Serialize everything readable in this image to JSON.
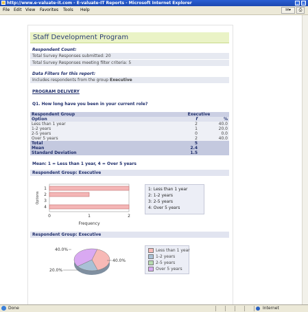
{
  "window": {
    "title": "http://www.e-valuate-it.com - E-valuate-IT Reports - Microsoft Internet Explorer"
  },
  "menu": {
    "items": [
      "File",
      "Edit",
      "View",
      "Favorites",
      "Tools",
      "Help"
    ]
  },
  "report": {
    "title": "Staff Development Program",
    "respondent_count_label": "Respondent Count:",
    "total_submitted": "Total Survey Responses submitted: 20",
    "total_meeting": "Total Survey Responses meeting filter criteria: 5",
    "filters_label": "Data Filters for this report:",
    "filter_text": "Includes respondents from the group",
    "filter_group": "Executive",
    "section_link": "PROGRAM DELIVERY",
    "question": "Q1. How long have you been in your current role?",
    "table": {
      "header_left": "Respondent Group",
      "header_right": "Executive",
      "option_label": "Option",
      "col_f": "f",
      "col_pct": "%",
      "rows": [
        {
          "option": "Less than 1 year",
          "f": "2",
          "pct": "40.0"
        },
        {
          "option": "1-2 years",
          "f": "1",
          "pct": "20.0"
        },
        {
          "option": "2-5 years",
          "f": "0",
          "pct": "0.0"
        },
        {
          "option": "Over 5 years",
          "f": "2",
          "pct": "40.0"
        }
      ],
      "total_label": "Total",
      "total_value": "5",
      "mean_label": "Mean",
      "mean_value": "2.4",
      "sd_label": "Standard Deviation",
      "sd_value": "1.5",
      "mean_note": "Mean: 1 = Less than 1 year, 4 = Over 5 years"
    },
    "bar_section_title": "Respondent Group: Executive",
    "pie_section_title": "Respondent Group: Executive"
  },
  "chart_data": [
    {
      "type": "bar",
      "orientation": "horizontal",
      "categories": [
        "1",
        "2",
        "3",
        "4"
      ],
      "values": [
        2,
        1,
        0,
        2
      ],
      "xlabel": "Frequency",
      "ylabel": "Options",
      "xlim": [
        0,
        2
      ],
      "x_ticks": [
        "0",
        "1",
        "2"
      ],
      "bar_color": "#f4b6b6",
      "legend": [
        "1:  Less than 1 year",
        "2:  1-2 years",
        "3:  2-5 years",
        "4:  Over 5 years"
      ]
    },
    {
      "type": "pie",
      "categories": [
        "Less than 1 year",
        "1-2 years",
        "2-5 years",
        "Over 5 years"
      ],
      "values": [
        40.0,
        20.0,
        0.0,
        40.0
      ],
      "labels": [
        "40.0%",
        "20.0%",
        "40.0%"
      ],
      "colors": [
        "#f7b9b6",
        "#a9c1d6",
        "#b7dcb0",
        "#d9a9f2"
      ],
      "legend": [
        "Less than 1 year",
        "1-2 years",
        "2-5 years",
        "Over 5 years"
      ]
    }
  ],
  "status": {
    "left": "Done",
    "zone": "Internet"
  }
}
